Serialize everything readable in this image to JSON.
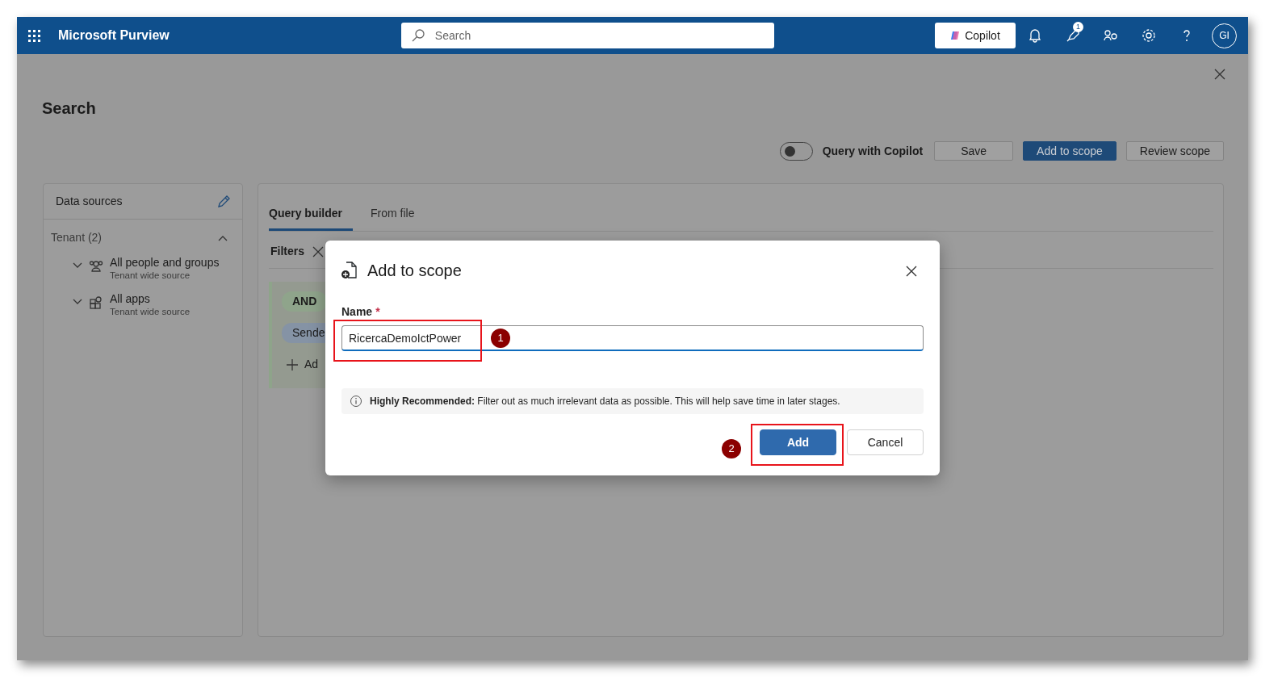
{
  "app": {
    "name": "Microsoft Purview",
    "search_placeholder": "Search",
    "copilot": "Copilot",
    "notification_count": "1",
    "avatar": "GI"
  },
  "page": {
    "title": "Search",
    "copilot_toggle": {
      "label": "Query with Copilot",
      "on": false
    },
    "actions": [
      {
        "label": "Save",
        "kind": "default"
      },
      {
        "label": "Add to scope",
        "kind": "primary"
      },
      {
        "label": "Review scope",
        "kind": "default"
      }
    ]
  },
  "data_sources": {
    "title": "Data sources",
    "group": {
      "label": "Tenant (2)",
      "expanded": true,
      "children": [
        {
          "label": "All people and groups",
          "sub": "Tenant wide source",
          "kind": "people",
          "expanded": false
        },
        {
          "label": "All apps",
          "sub": "Tenant wide source",
          "kind": "apps",
          "expanded": false
        }
      ]
    }
  },
  "query": {
    "tabs": [
      {
        "label": "Query builder",
        "selected": true
      },
      {
        "label": "From file",
        "selected": false
      }
    ],
    "filters_label": "Filters",
    "operator": "AND",
    "condition": "Sende",
    "add_label": "Ad"
  },
  "dialog": {
    "title": "Add to scope",
    "name_label": "Name",
    "required_mark": "*",
    "name_value": "RicercaDemoIctPower",
    "info": "**Highly Recommended:** Filter out as much irrelevant data as possible. This will help save time in later stages.",
    "buttons": [
      {
        "label": "Add",
        "kind": "primary"
      },
      {
        "label": "Cancel",
        "kind": "default"
      }
    ]
  },
  "callouts": [
    {
      "number": "1"
    },
    {
      "number": "2"
    }
  ]
}
